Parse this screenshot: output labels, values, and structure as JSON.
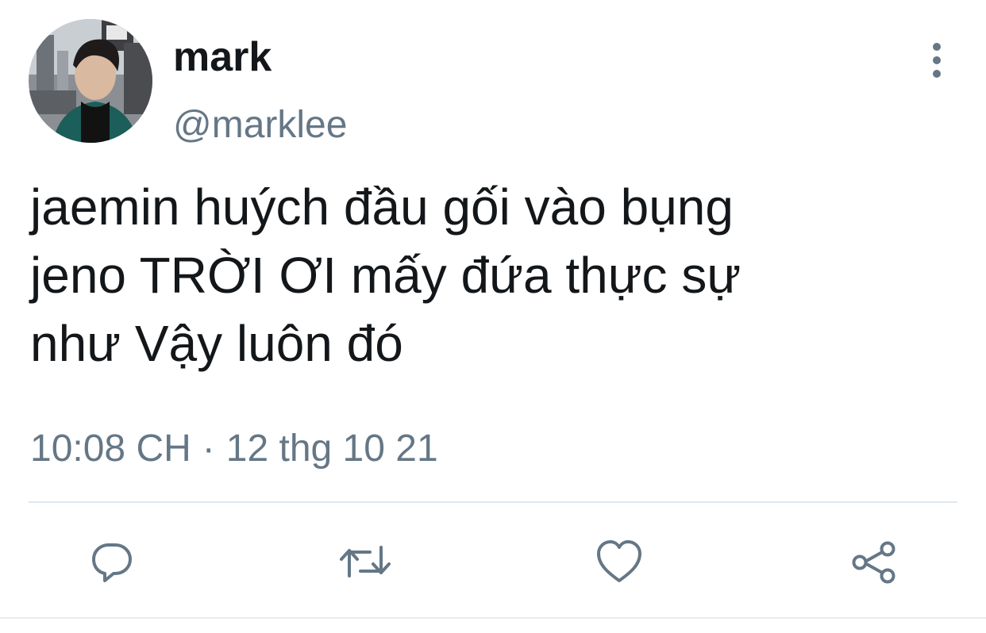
{
  "tweet": {
    "avatar_icon": "profile-photo",
    "display_name": "mark",
    "handle": "@marklee",
    "text": "jaemin huých đầu gối vào bụng\njeno TRỜI ƠI mấy đứa thực sự\nnhư Vậy luôn đó",
    "time": "10:08 CH",
    "separator": "·",
    "date": "12 thg 10 21",
    "more_icon": "more-vertical-icon"
  },
  "actions": {
    "icons": [
      "reply-icon",
      "retweet-icon",
      "like-icon",
      "share-icon"
    ]
  },
  "colors": {
    "text": "#14171a",
    "secondary": "#657786",
    "divider": "#e1e8ed"
  }
}
